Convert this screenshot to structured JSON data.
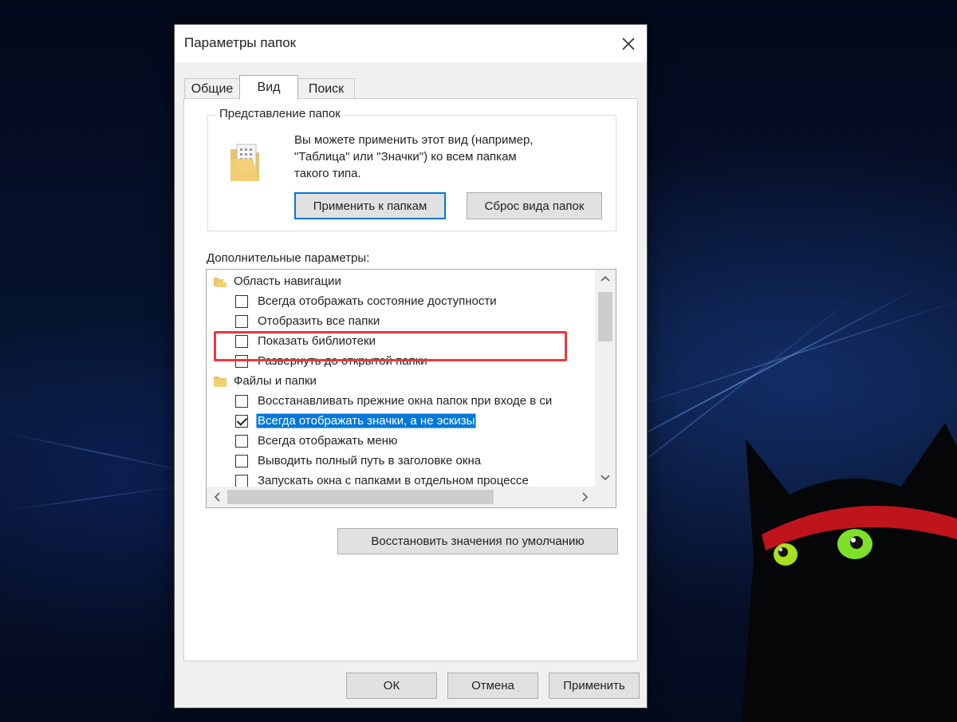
{
  "window": {
    "title": "Параметры папок",
    "close_icon": "×"
  },
  "tabs": [
    {
      "label": "Общие",
      "active": false
    },
    {
      "label": "Вид",
      "active": true
    },
    {
      "label": "Поиск",
      "active": false
    }
  ],
  "folder_views": {
    "group_label": "Представление папок",
    "description_lines": [
      "Вы можете применить этот вид (например,",
      "\"Таблица\" или \"Значки\") ко всем папкам",
      "такого типа."
    ],
    "apply_button": "Применить к папкам",
    "reset_button": "Сброс вида папок"
  },
  "advanced": {
    "label": "Дополнительные параметры:",
    "rows": [
      {
        "type": "category",
        "label": "Область навигации",
        "icon": "navigation-pane-icon"
      },
      {
        "type": "checkbox",
        "label": "Всегда отображать состояние доступности",
        "checked": false
      },
      {
        "type": "checkbox",
        "label": "Отобразить все папки",
        "checked": false
      },
      {
        "type": "checkbox",
        "label": "Показать библиотеки",
        "checked": false
      },
      {
        "type": "checkbox",
        "label": "Развернуть до открытой папки",
        "checked": false
      },
      {
        "type": "category",
        "label": "Файлы и папки",
        "icon": "folder-icon"
      },
      {
        "type": "checkbox",
        "label": "Восстанавливать прежние окна папок при входе в си",
        "checked": false
      },
      {
        "type": "checkbox",
        "label": "Всегда отображать значки, а не эскизы",
        "checked": true,
        "selected": true
      },
      {
        "type": "checkbox",
        "label": "Всегда отображать меню",
        "checked": false
      },
      {
        "type": "checkbox",
        "label": "Выводить полный путь в заголовке окна",
        "checked": false
      },
      {
        "type": "checkbox",
        "label": "Запускать окна с папками в отдельном процессе",
        "checked": false
      }
    ],
    "restore_defaults_button": "Восстановить значения по умолчанию"
  },
  "footer": {
    "ok": "ОК",
    "cancel": "Отмена",
    "apply": "Применить"
  },
  "colors": {
    "accent": "#0078d7",
    "highlight_border": "#e8393f"
  }
}
